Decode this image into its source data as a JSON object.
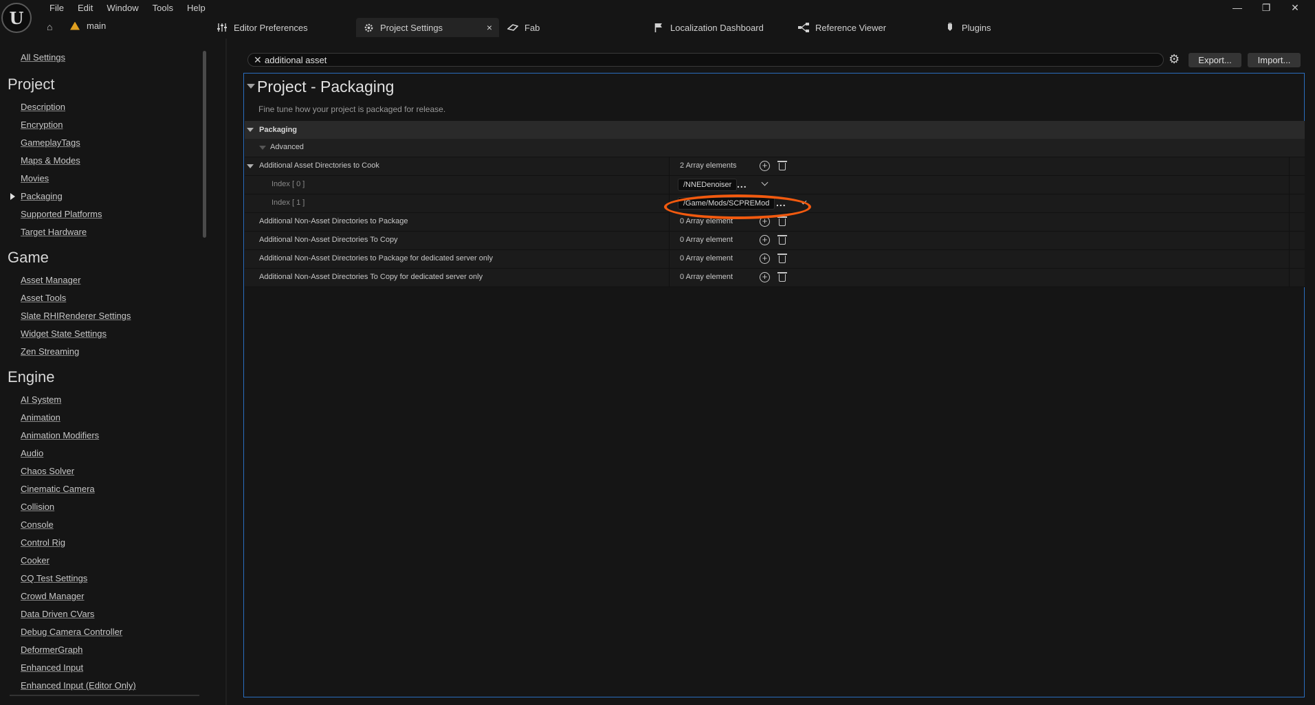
{
  "menu": [
    "File",
    "Edit",
    "Window",
    "Tools",
    "Help"
  ],
  "window_controls": [
    "—",
    "❐",
    "✕"
  ],
  "project_tab": {
    "label": "main"
  },
  "tabs": [
    {
      "label": "Editor Preferences",
      "icon": "sliders-icon"
    },
    {
      "label": "Project Settings",
      "icon": "settings-gear-icon",
      "active": true
    },
    {
      "label": "Fab",
      "icon": "fab-icon"
    },
    {
      "label": "Localization Dashboard",
      "icon": "flag-icon"
    },
    {
      "label": "Reference Viewer",
      "icon": "node-graph-icon"
    },
    {
      "label": "Plugins",
      "icon": "plug-icon"
    }
  ],
  "sidebar": {
    "all_settings": "All Settings",
    "sections": [
      {
        "title": "Project",
        "items": [
          "Description",
          "Encryption",
          "GameplayTags",
          "Maps & Modes",
          "Movies",
          "Packaging",
          "Supported Platforms",
          "Target Hardware"
        ]
      },
      {
        "title": "Game",
        "items": [
          "Asset Manager",
          "Asset Tools",
          "Slate RHIRenderer Settings",
          "Widget State Settings",
          "Zen Streaming"
        ]
      },
      {
        "title": "Engine",
        "items": [
          "AI System",
          "Animation",
          "Animation Modifiers",
          "Audio",
          "Chaos Solver",
          "Cinematic Camera",
          "Collision",
          "Console",
          "Control Rig",
          "Cooker",
          "CQ Test Settings",
          "Crowd Manager",
          "Data Driven CVars",
          "Debug Camera Controller",
          "DeformerGraph",
          "Enhanced Input",
          "Enhanced Input (Editor Only)"
        ]
      }
    ],
    "selected": "Packaging"
  },
  "search": {
    "value": "additional asset"
  },
  "toolbar": {
    "export": "Export...",
    "import": "Import..."
  },
  "panel": {
    "title": "Project - Packaging",
    "description": "Fine tune how your project is packaged for release.",
    "section": "Packaging",
    "subsection": "Advanced",
    "rows": {
      "cook_dirs": {
        "label": "Additional Asset Directories to Cook",
        "count": "2 Array elements"
      },
      "index0": {
        "label": "Index [ 0 ]",
        "value": "/NNEDenoiser"
      },
      "index1": {
        "label": "Index [ 1 ]",
        "value": "/Game/Mods/SCPREMod"
      },
      "nonasset_pkg": {
        "label": "Additional Non-Asset Directories to Package",
        "count": "0 Array element"
      },
      "nonasset_copy": {
        "label": "Additional Non-Asset Directories To Copy",
        "count": "0 Array element"
      },
      "nonasset_pkg_ds": {
        "label": "Additional Non-Asset Directories to Package for dedicated server only",
        "count": "0 Array element"
      },
      "nonasset_copy_ds": {
        "label": "Additional Non-Asset Directories To Copy for dedicated server only",
        "count": "0 Array element"
      }
    }
  },
  "colors": {
    "highlight": "#f25a0f",
    "panel_border": "#2a6ec0",
    "project_icon": "#e0a020"
  }
}
